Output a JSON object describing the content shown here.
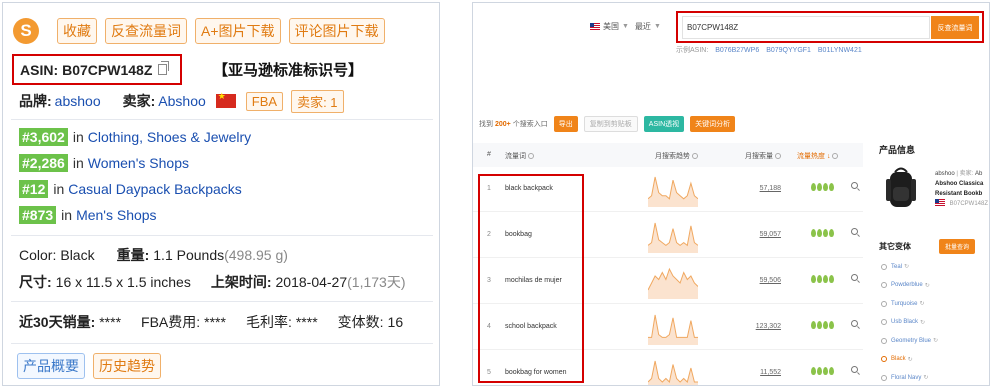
{
  "left": {
    "logo_letter": "S",
    "top_buttons": [
      "收藏",
      "反查流量词",
      "A+图片下载",
      "评论图片下载"
    ],
    "asin_label": "ASIN:",
    "asin_value": "B07CPW148Z",
    "asin_note": "【亚马逊标准标识号】",
    "brand_label": "品牌:",
    "brand_value": "abshoo",
    "seller_label": "卖家:",
    "seller_value": "Abshoo",
    "fba_badge": "FBA",
    "seller_count_badge": "卖家: 1",
    "rankings": [
      {
        "rank": "#3,602",
        "in": "in",
        "category": "Clothing, Shoes & Jewelry"
      },
      {
        "rank": "#2,286",
        "in": "in",
        "category": "Women's Shops"
      },
      {
        "rank": "#12",
        "in": "in",
        "category": "Casual Daypack Backpacks"
      },
      {
        "rank": "#873",
        "in": "in",
        "category": "Men's Shops"
      }
    ],
    "color_label": "Color:",
    "color_value": "Black",
    "weight_label": "重量:",
    "weight_value": "1.1 Pounds",
    "weight_grams": "(498.95 g)",
    "size_label": "尺寸:",
    "size_value": "16 x 11.5 x 1.5 inches",
    "launch_label": "上架时间:",
    "launch_value": "2018-04-27",
    "launch_days": "(1,173天)",
    "sales_label": "近30天销量:",
    "sales_value": "****",
    "fba_fee_label": "FBA费用:",
    "fba_fee_value": "****",
    "margin_label": "毛利率:",
    "margin_value": "****",
    "variants_label": "变体数:",
    "variants_value": "16",
    "bottom_buttons": [
      "产品概要",
      "历史趋势"
    ]
  },
  "right": {
    "country": "美国",
    "period": "最近",
    "search_value": "B07CPW148Z",
    "search_button": "反查流量词",
    "examples_label": "示例ASIN:",
    "examples": [
      "B076B27WP6",
      "B079QYYGF1",
      "B01LYNW421"
    ],
    "found_prefix": "找到",
    "found_count": "200+",
    "found_suffix": "个搜索入口",
    "toolbar": {
      "export": "导出",
      "copy": "复制到剪贴板",
      "asin_view": "ASIN透视",
      "keyword_analysis": "关键词分析"
    },
    "headers": {
      "num": "#",
      "keyword": "流量词",
      "trend": "月搜索趋势",
      "volume": "月搜索量",
      "hot": "流量热度 ↓"
    },
    "rows": [
      {
        "num": "1",
        "keyword": "black backpack",
        "volume": "57,188",
        "trend": [
          2,
          3,
          9,
          4,
          3,
          3,
          2,
          8,
          4,
          3,
          2,
          3,
          7,
          3,
          2
        ]
      },
      {
        "num": "2",
        "keyword": "bookbag",
        "volume": "59,057",
        "trend": [
          2,
          3,
          10,
          4,
          3,
          2,
          3,
          8,
          3,
          2,
          3,
          2,
          9,
          3,
          2
        ]
      },
      {
        "num": "3",
        "keyword": "mochilas de mujer",
        "volume": "59,506",
        "trend": [
          2,
          4,
          6,
          5,
          7,
          5,
          8,
          6,
          5,
          4,
          7,
          5,
          6,
          4,
          3
        ]
      },
      {
        "num": "4",
        "keyword": "school backpack",
        "volume": "123,302",
        "trend": [
          2,
          2,
          10,
          3,
          2,
          2,
          3,
          9,
          2,
          2,
          2,
          2,
          8,
          2,
          2
        ]
      },
      {
        "num": "5",
        "keyword": "bookbag for women",
        "volume": "11,552",
        "trend": [
          2,
          3,
          8,
          3,
          2,
          3,
          2,
          7,
          3,
          2,
          3,
          2,
          6,
          2,
          2
        ]
      }
    ],
    "product_info_title": "产品信息",
    "product": {
      "seller": "abshoo",
      "sold_by": "| 卖家:",
      "sold_by_value": "Ab",
      "title1": "Abshoo Classica",
      "title2": "Resistant Bookb",
      "asin": "B07CPW148Z"
    },
    "variants_title": "其它变体",
    "variants_button": "批量查询",
    "variants": [
      "Teal",
      "Powderblue",
      "Turquoise",
      "Usb Black",
      "Geometry Blue",
      "Black",
      "Floral Navy"
    ],
    "active_variant": "Black",
    "colors": {
      "accent": "#f08419",
      "rank_green": "#6cc24a",
      "highlight_red": "#d40000",
      "link_blue": "#1a4fb0"
    }
  }
}
